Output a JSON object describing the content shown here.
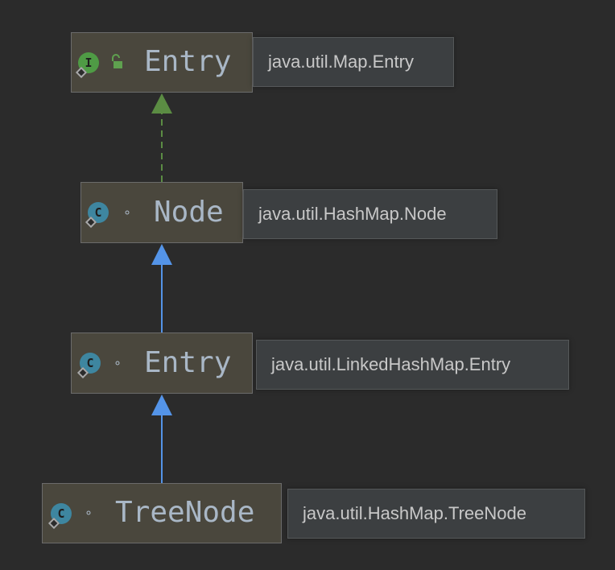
{
  "nodes": [
    {
      "id": "entry-map",
      "kind": "interface",
      "icon_letter": "I",
      "modifier": "public",
      "name": "Entry",
      "fqn": "java.util.Map.Entry"
    },
    {
      "id": "node",
      "kind": "class",
      "icon_letter": "C",
      "modifier": "package-private",
      "name": "Node",
      "fqn": "java.util.HashMap.Node"
    },
    {
      "id": "entry-linked",
      "kind": "class",
      "icon_letter": "C",
      "modifier": "package-private",
      "name": "Entry",
      "fqn": "java.util.LinkedHashMap.Entry"
    },
    {
      "id": "treenode",
      "kind": "final-class",
      "icon_letter": "C",
      "modifier": "package-private",
      "name": "TreeNode",
      "fqn": "java.util.HashMap.TreeNode"
    }
  ],
  "edges": [
    {
      "from": "node",
      "to": "entry-map",
      "type": "implements",
      "style": "dashed",
      "color": "#5b8c43"
    },
    {
      "from": "entry-linked",
      "to": "node",
      "type": "extends",
      "style": "solid",
      "color": "#5494e8"
    },
    {
      "from": "treenode",
      "to": "entry-linked",
      "type": "extends",
      "style": "solid",
      "color": "#5494e8"
    }
  ],
  "colors": {
    "background": "#2b2b2b",
    "node_fill": "#4a473d",
    "tooltip_fill": "#3c3f41",
    "interface_icon": "#4f9b45",
    "class_icon": "#3e86a0"
  }
}
